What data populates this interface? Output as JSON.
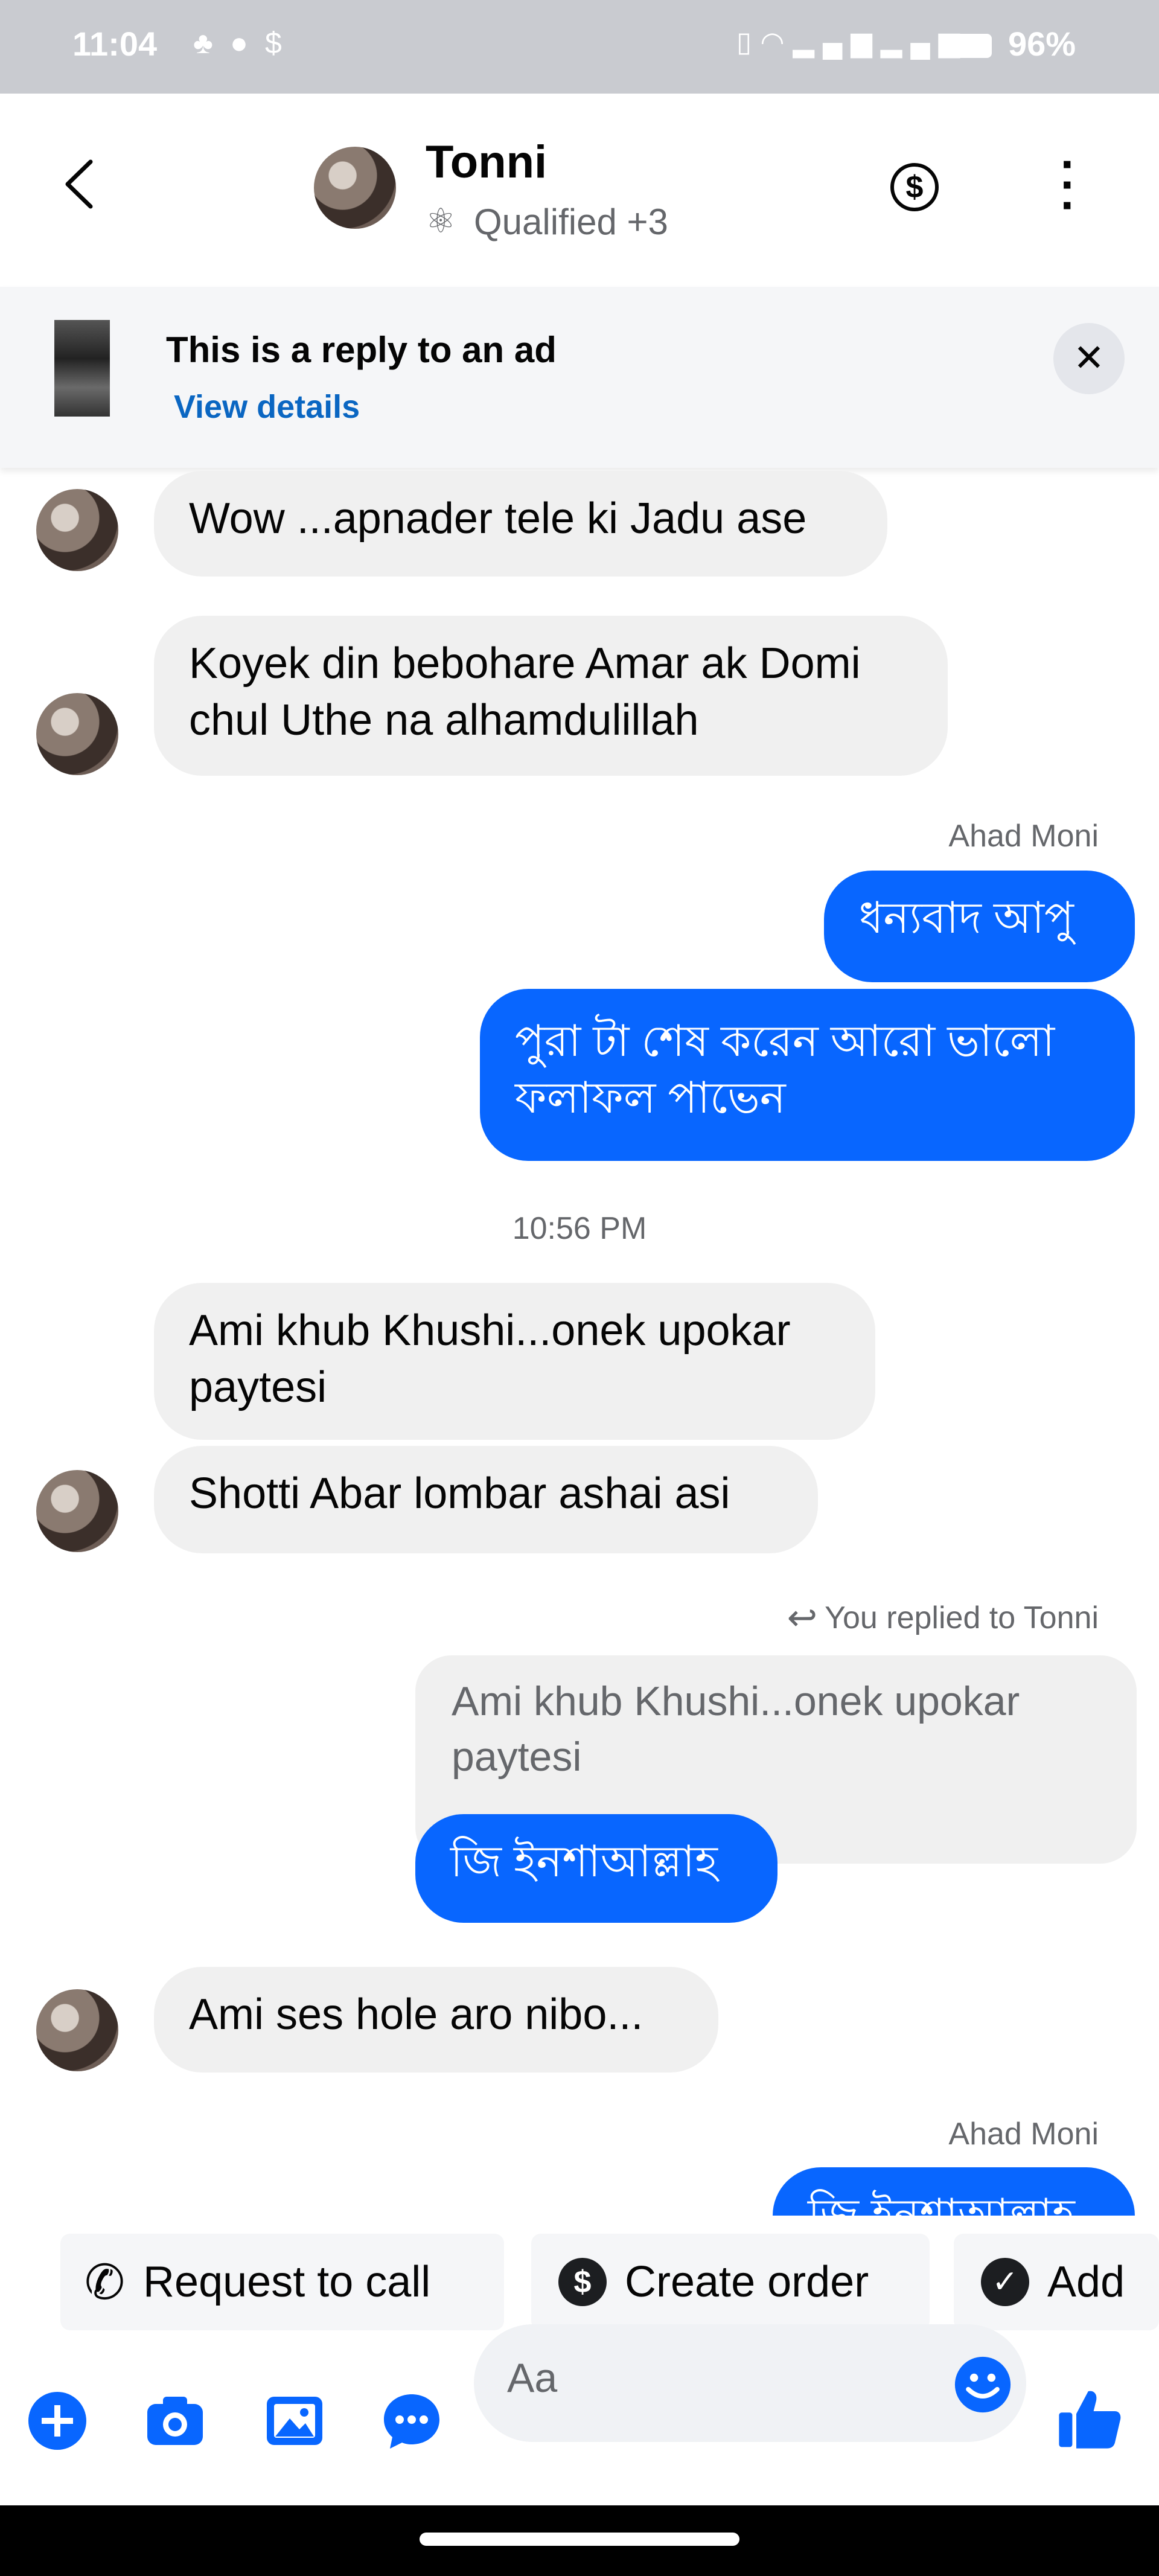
{
  "status_bar": {
    "time": "11:04",
    "left_icons": [
      "snapchat-icon",
      "messenger-icon",
      "dollar-icon"
    ],
    "right_icons": [
      "vibrate-icon",
      "wifi-icon",
      "signal-icon",
      "signal-icon",
      "battery-icon"
    ],
    "battery": "96%"
  },
  "header": {
    "contact_name": "Tonni",
    "contact_label": "Qualified +3",
    "colors": {
      "text": "#050505",
      "muted": "#65676b"
    }
  },
  "ad_banner": {
    "title": "This is a reply to an ad",
    "link": "View details"
  },
  "messages": {
    "m1": "Wow ...apnader tele ki Jadu ase",
    "m2_line1": "Koyek din bebohare Amar ak Domi",
    "m2_line2": "chul Uthe na alhamdulillah",
    "sender1": "Ahad Moni",
    "m3": "ধন্যবাদ আপু",
    "m4_line1": "পুরা টা শেষ করেন আরো ভালো",
    "m4_line2": "ফলাফল পাভেন",
    "timestamp": "10:56 PM",
    "m5_line1": "Ami khub Khushi...onek upokar",
    "m5_line2": "paytesi",
    "m6": "Shotti Abar lombar ashai asi",
    "reply_note": "You replied to Tonni",
    "quote_line1": "Ami khub Khushi...onek upokar",
    "quote_line2": "paytesi",
    "m7": "জি ইনশাআল্লাহ",
    "m8": "Ami ses hole aro nibo...",
    "sender2": "Ahad Moni",
    "m9_partial": "জি ইনশাআল্লাহ"
  },
  "quick_actions": {
    "request_call": "Request to call",
    "create_order": "Create order",
    "add": "Add"
  },
  "composer": {
    "placeholder": "Aa"
  },
  "colors": {
    "outgoing": "#0866ff",
    "incoming": "#f0f0f0",
    "link": "#0a66c2"
  }
}
